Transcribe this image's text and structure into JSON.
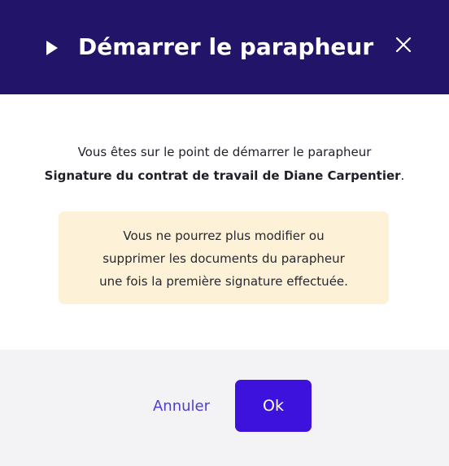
{
  "dialog": {
    "title": "Démarrer le parapheur",
    "title_icon": "play-triangle-icon",
    "close_icon": "close-icon"
  },
  "message": {
    "line1": "Vous êtes sur le point de démarrer le parapheur",
    "document_name": "Signature du contrat de travail de Diane Carpentier",
    "trailing_period": "."
  },
  "warning": {
    "line1": "Vous ne pourrez plus modifier ou",
    "line2": "supprimer les documents du parapheur",
    "line3": "une fois la première signature effectuée."
  },
  "footer": {
    "cancel_label": "Annuler",
    "ok_label": "Ok"
  },
  "colors": {
    "header_bg": "#221468",
    "primary": "#3c12dc",
    "link": "#4d3fcf",
    "warning_bg": "#fdf1d8",
    "footer_bg": "#f3f3f6"
  }
}
